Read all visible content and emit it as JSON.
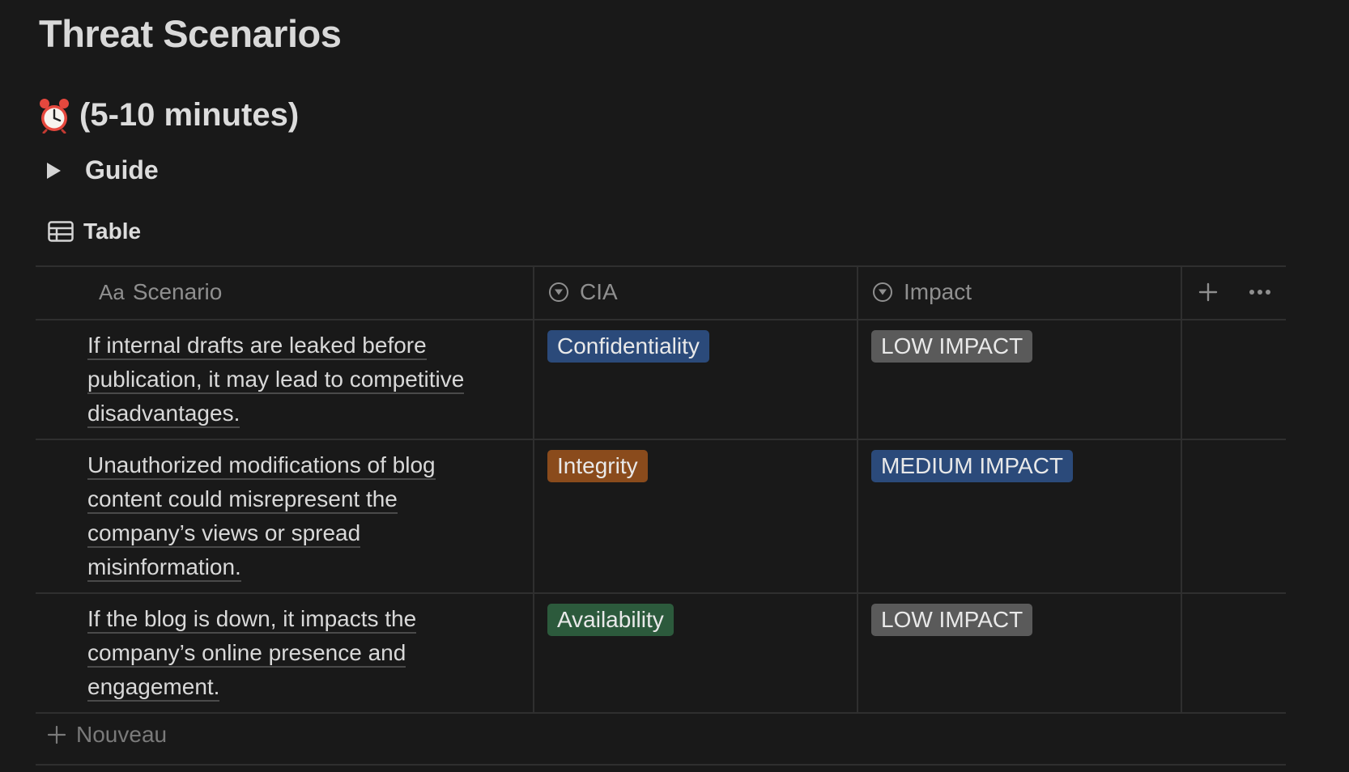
{
  "page": {
    "title": "Threat Scenarios"
  },
  "section": {
    "emoji_icon": "alarm-clock-icon",
    "heading": "(5-10 minutes)"
  },
  "toggle": {
    "label": "Guide",
    "state": "collapsed"
  },
  "view": {
    "icon": "table-icon",
    "label": "Table"
  },
  "table": {
    "columns": [
      {
        "type_label": "Aa",
        "label": "Scenario"
      },
      {
        "type_icon": "select-icon",
        "label": "CIA"
      },
      {
        "type_icon": "select-icon",
        "label": "Impact"
      }
    ],
    "rows": [
      {
        "scenario_lines": [
          "If internal drafts are leaked before",
          "publication, it may lead to competitive",
          "disadvantages."
        ],
        "cia": {
          "label": "Confidentiality",
          "color": "#2b4a7a"
        },
        "impact": {
          "label": "LOW IMPACT",
          "color": "#5a5a5a"
        }
      },
      {
        "scenario_lines": [
          "Unauthorized modifications of blog",
          "content could misrepresent the",
          "company’s views or spread",
          "misinformation."
        ],
        "cia": {
          "label": "Integrity",
          "color": "#8a4b1c"
        },
        "impact": {
          "label": "MEDIUM IMPACT",
          "color": "#2b4a7a"
        }
      },
      {
        "scenario_lines": [
          "If the blog is down, it impacts the",
          "company’s online presence and",
          "engagement."
        ],
        "cia": {
          "label": "Availability",
          "color": "#2c5a3c"
        },
        "impact": {
          "label": "LOW IMPACT",
          "color": "#5a5a5a"
        }
      }
    ],
    "new_row_label": "Nouveau"
  }
}
